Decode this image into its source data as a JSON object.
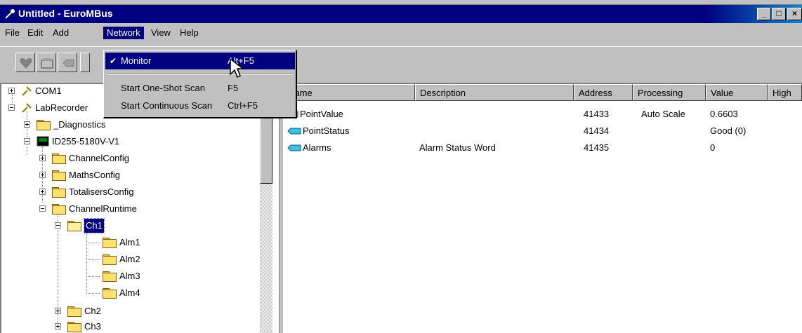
{
  "window": {
    "title": "Untitled - EuroMBus",
    "controls": {
      "minimize": "_",
      "maximize": "□",
      "close": "×"
    }
  },
  "menubar": {
    "items": [
      {
        "label": "File",
        "mnemonic": "F"
      },
      {
        "label": "Edit",
        "mnemonic": "E"
      },
      {
        "label": "Add",
        "mnemonic": "A"
      },
      {
        "label": "Network",
        "mnemonic": "N"
      },
      {
        "label": "View",
        "mnemonic": "V"
      },
      {
        "label": "Help",
        "mnemonic": "H"
      }
    ]
  },
  "network_menu": {
    "items": [
      {
        "label": "Monitor",
        "shortcut": "Alt+F5",
        "checked": true,
        "highlighted": true
      },
      {
        "label": "Start One-Shot Scan",
        "shortcut": "F5"
      },
      {
        "label": "Start Continuous Scan",
        "shortcut": "Ctrl+F5"
      }
    ]
  },
  "tree": {
    "nodes": [
      {
        "label": "COM1",
        "icon": "serial-port-icon",
        "expander": "plus"
      },
      {
        "label": "LabRecorder",
        "icon": "serial-port-icon",
        "expander": "minus"
      },
      {
        "label": "_Diagnostics",
        "icon": "folder-icon",
        "expander": "plus"
      },
      {
        "label": "ID255-5180V-V1",
        "icon": "device-icon",
        "expander": "minus"
      },
      {
        "label": "ChannelConfig",
        "icon": "folder-icon",
        "expander": "plus"
      },
      {
        "label": "MathsConfig",
        "icon": "folder-icon",
        "expander": "plus"
      },
      {
        "label": "TotalisersConfig",
        "icon": "folder-icon",
        "expander": "plus"
      },
      {
        "label": "ChannelRuntime",
        "icon": "folder-icon",
        "expander": "minus"
      },
      {
        "label": "Ch1",
        "icon": "open-folder-icon",
        "expander": "minus",
        "selected": true
      },
      {
        "label": "Alm1",
        "icon": "folder-icon"
      },
      {
        "label": "Alm2",
        "icon": "folder-icon"
      },
      {
        "label": "Alm3",
        "icon": "folder-icon"
      },
      {
        "label": "Alm4",
        "icon": "folder-icon"
      },
      {
        "label": "Ch2",
        "icon": "folder-icon",
        "expander": "plus"
      },
      {
        "label": "Ch3",
        "icon": "folder-icon",
        "expander": "plus"
      }
    ]
  },
  "list": {
    "columns": [
      "Name",
      "Description",
      "Address",
      "Processing",
      "Value",
      "High"
    ],
    "rows": [
      {
        "name": "PointValue",
        "description": "",
        "address": "41433",
        "processing": "Auto Scale",
        "value": "0.6603"
      },
      {
        "name": "PointStatus",
        "description": "",
        "address": "41434",
        "processing": "",
        "value": "Good (0)"
      },
      {
        "name": "Alarms",
        "description": "Alarm Status Word",
        "address": "41435",
        "processing": "",
        "value": "0"
      }
    ]
  },
  "colors": {
    "titlebar": "#000080",
    "selection": "#000080",
    "face": "#c0c0c0",
    "folder": "#ffe070"
  }
}
